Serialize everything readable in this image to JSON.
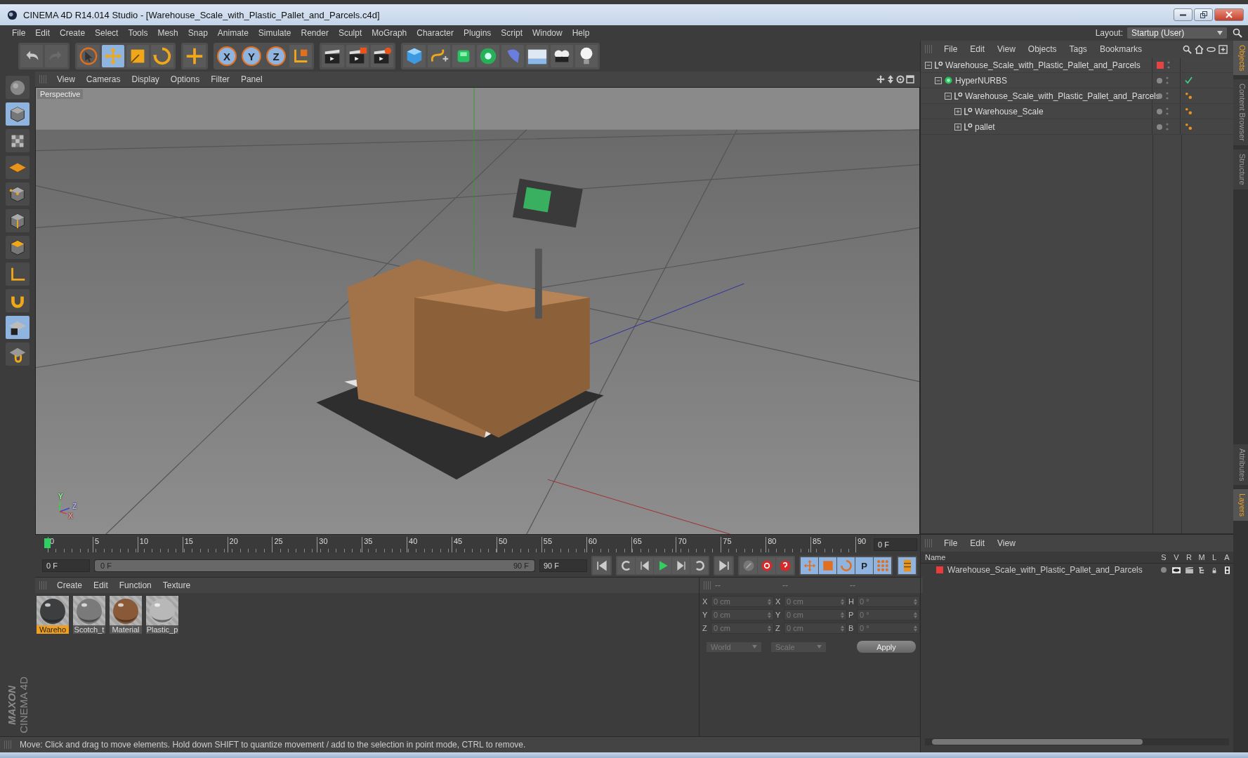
{
  "window": {
    "title": "CINEMA 4D R14.014 Studio - [Warehouse_Scale_with_Plastic_Pallet_and_Parcels.c4d]"
  },
  "menu_bar": [
    "File",
    "Edit",
    "Create",
    "Select",
    "Tools",
    "Mesh",
    "Snap",
    "Animate",
    "Simulate",
    "Render",
    "Sculpt",
    "MoGraph",
    "Character",
    "Plugins",
    "Script",
    "Window",
    "Help"
  ],
  "layout": {
    "label": "Layout:",
    "value": "Startup (User)"
  },
  "toolbar": [
    {
      "tools": [
        {
          "kind": "undo",
          "selected": false
        },
        {
          "kind": "redo",
          "selected": false
        }
      ]
    },
    {
      "tools": [
        {
          "kind": "select",
          "selected": false
        },
        {
          "kind": "move",
          "selected": true
        },
        {
          "kind": "scale",
          "selected": false
        },
        {
          "kind": "rotate",
          "selected": false
        }
      ]
    },
    {
      "tools": [
        {
          "kind": "add",
          "selected": false
        }
      ]
    },
    {
      "tools": [
        {
          "kind": "axis",
          "glyph": "X",
          "selected": true
        },
        {
          "kind": "axis",
          "glyph": "Y",
          "selected": true
        },
        {
          "kind": "axis",
          "glyph": "Z",
          "selected": true
        },
        {
          "kind": "coords",
          "selected": false
        }
      ]
    },
    {
      "tools": [
        {
          "kind": "render-view",
          "selected": false
        },
        {
          "kind": "render-picture",
          "selected": false
        },
        {
          "kind": "render-settings",
          "selected": false
        }
      ]
    },
    {
      "tools": [
        {
          "kind": "cube",
          "selected": false
        },
        {
          "kind": "spline",
          "selected": false
        },
        {
          "kind": "nurbs",
          "selected": false
        },
        {
          "kind": "array",
          "selected": false
        },
        {
          "kind": "deformer",
          "selected": false
        },
        {
          "kind": "floor",
          "selected": false
        },
        {
          "kind": "camera",
          "selected": false
        },
        {
          "kind": "light",
          "selected": false
        }
      ]
    }
  ],
  "left_toolbar": [
    {
      "kind": "view",
      "selected": false
    },
    {
      "kind": "model",
      "selected": true
    },
    {
      "kind": "texture",
      "selected": false
    },
    {
      "kind": "workplane",
      "selected": false
    },
    {
      "kind": "points",
      "selected": false
    },
    {
      "kind": "edges",
      "selected": false
    },
    {
      "kind": "polygons",
      "selected": false
    },
    {
      "kind": "axis",
      "selected": false
    },
    {
      "kind": "magnet",
      "selected": false
    },
    {
      "kind": "lock",
      "selected": true
    },
    {
      "kind": "snap",
      "selected": false
    }
  ],
  "logo": {
    "brand": "MAXON",
    "product": "CINEMA 4D"
  },
  "viewport": {
    "menu": [
      "View",
      "Cameras",
      "Display",
      "Options",
      "Filter",
      "Panel"
    ],
    "label": "Perspective",
    "axis_labels": [
      "Y",
      "Z",
      "X"
    ]
  },
  "timeline": {
    "ticks": [
      "0",
      "5",
      "10",
      "15",
      "20",
      "25",
      "30",
      "35",
      "40",
      "45",
      "50",
      "55",
      "60",
      "65",
      "70",
      "75",
      "80",
      "85",
      "90"
    ],
    "current": "0 F",
    "start": "0 F",
    "range_start": "0 F",
    "range_end": "90 F",
    "range": {
      "level": 1
    },
    "end": "90 F",
    "controls": [
      {
        "buttons": [
          {
            "kind": "first"
          }
        ]
      },
      {
        "buttons": [
          {
            "kind": "prev-key"
          },
          {
            "kind": "prev-frame"
          },
          {
            "kind": "play"
          },
          {
            "kind": "next-frame"
          },
          {
            "kind": "next-key"
          }
        ]
      },
      {
        "buttons": [
          {
            "kind": "last"
          }
        ]
      },
      {
        "buttons": [
          {
            "kind": "key-off"
          },
          {
            "kind": "record"
          },
          {
            "kind": "auto"
          }
        ]
      },
      {
        "buttons": [
          {
            "kind": "key-move"
          },
          {
            "kind": "key-scale"
          },
          {
            "kind": "key-rotate"
          },
          {
            "kind": "key-param",
            "glyph": "P"
          },
          {
            "kind": "key-points"
          }
        ]
      },
      {
        "buttons": [
          {
            "kind": "timeline"
          }
        ]
      }
    ]
  },
  "materials": {
    "menu": [
      "Create",
      "Edit",
      "Function",
      "Texture"
    ],
    "items": [
      {
        "name": "Wareho",
        "color": "#3c3e40",
        "selected": true
      },
      {
        "name": "Scotch_t",
        "color": "#7a7a7a",
        "selected": false
      },
      {
        "name": "Material",
        "color": "#8a5a38",
        "selected": false
      },
      {
        "name": "Plastic_p",
        "color": "#b8b8b8",
        "selected": false
      }
    ]
  },
  "coordinates": {
    "disabled": true,
    "headers": [
      "--",
      "--",
      "--"
    ],
    "columns": [
      [
        {
          "axis": "X",
          "value": "0 cm"
        },
        {
          "axis": "Y",
          "value": "0 cm"
        },
        {
          "axis": "Z",
          "value": "0 cm"
        }
      ],
      [
        {
          "axis": "X",
          "value": "0 cm"
        },
        {
          "axis": "Y",
          "value": "0 cm"
        },
        {
          "axis": "Z",
          "value": "0 cm"
        }
      ],
      [
        {
          "axis": "H",
          "value": "0 °"
        },
        {
          "axis": "P",
          "value": "0 °"
        },
        {
          "axis": "B",
          "value": "0 °"
        }
      ]
    ],
    "dropdowns": [
      "World",
      "Scale"
    ],
    "apply": "Apply"
  },
  "objects": {
    "menu": [
      "File",
      "Edit",
      "View",
      "Objects",
      "Tags",
      "Bookmarks"
    ],
    "tree": [
      {
        "name": "Warehouse_Scale_with_Plastic_Pallet_and_Parcels",
        "kind": "null",
        "expanded": true,
        "color": "#e84343",
        "children": [
          {
            "name": "HyperNURBS",
            "kind": "nurbs",
            "expanded": true,
            "tags": [
              {
                "kind": "check"
              }
            ],
            "children": [
              {
                "name": "Warehouse_Scale_with_Plastic_Pallet_and_Parcels",
                "kind": "null",
                "expanded": true,
                "tags": [
                  {
                    "kind": "material"
                  }
                ],
                "children": [
                  {
                    "name": "Warehouse_Scale",
                    "kind": "null",
                    "expanded": false,
                    "tags": [
                      {
                        "kind": "material"
                      }
                    ]
                  },
                  {
                    "name": "pallet",
                    "kind": "null",
                    "expanded": false,
                    "tags": [
                      {
                        "kind": "material"
                      }
                    ]
                  }
                ]
              }
            ]
          }
        ]
      }
    ]
  },
  "layers": {
    "menu": [
      "File",
      "Edit",
      "View"
    ],
    "columns": [
      "Name",
      "S",
      "V",
      "R",
      "M",
      "L",
      "A"
    ],
    "rows": [
      {
        "name": "Warehouse_Scale_with_Plastic_Pallet_and_Parcels",
        "color": "#e83c3c"
      }
    ]
  },
  "side_tabs_top": [
    {
      "label": "Objects",
      "selected": true
    },
    {
      "label": "Content Browser",
      "selected": false
    },
    {
      "label": "Structure",
      "selected": false
    }
  ],
  "side_tabs_bottom": [
    {
      "label": "Attributes",
      "selected": false
    },
    {
      "label": "Layers",
      "selected": true
    }
  ],
  "status_bar": "Move: Click and drag to move elements. Hold down SHIFT to quantize movement / add to the selection in point mode, CTRL to remove."
}
